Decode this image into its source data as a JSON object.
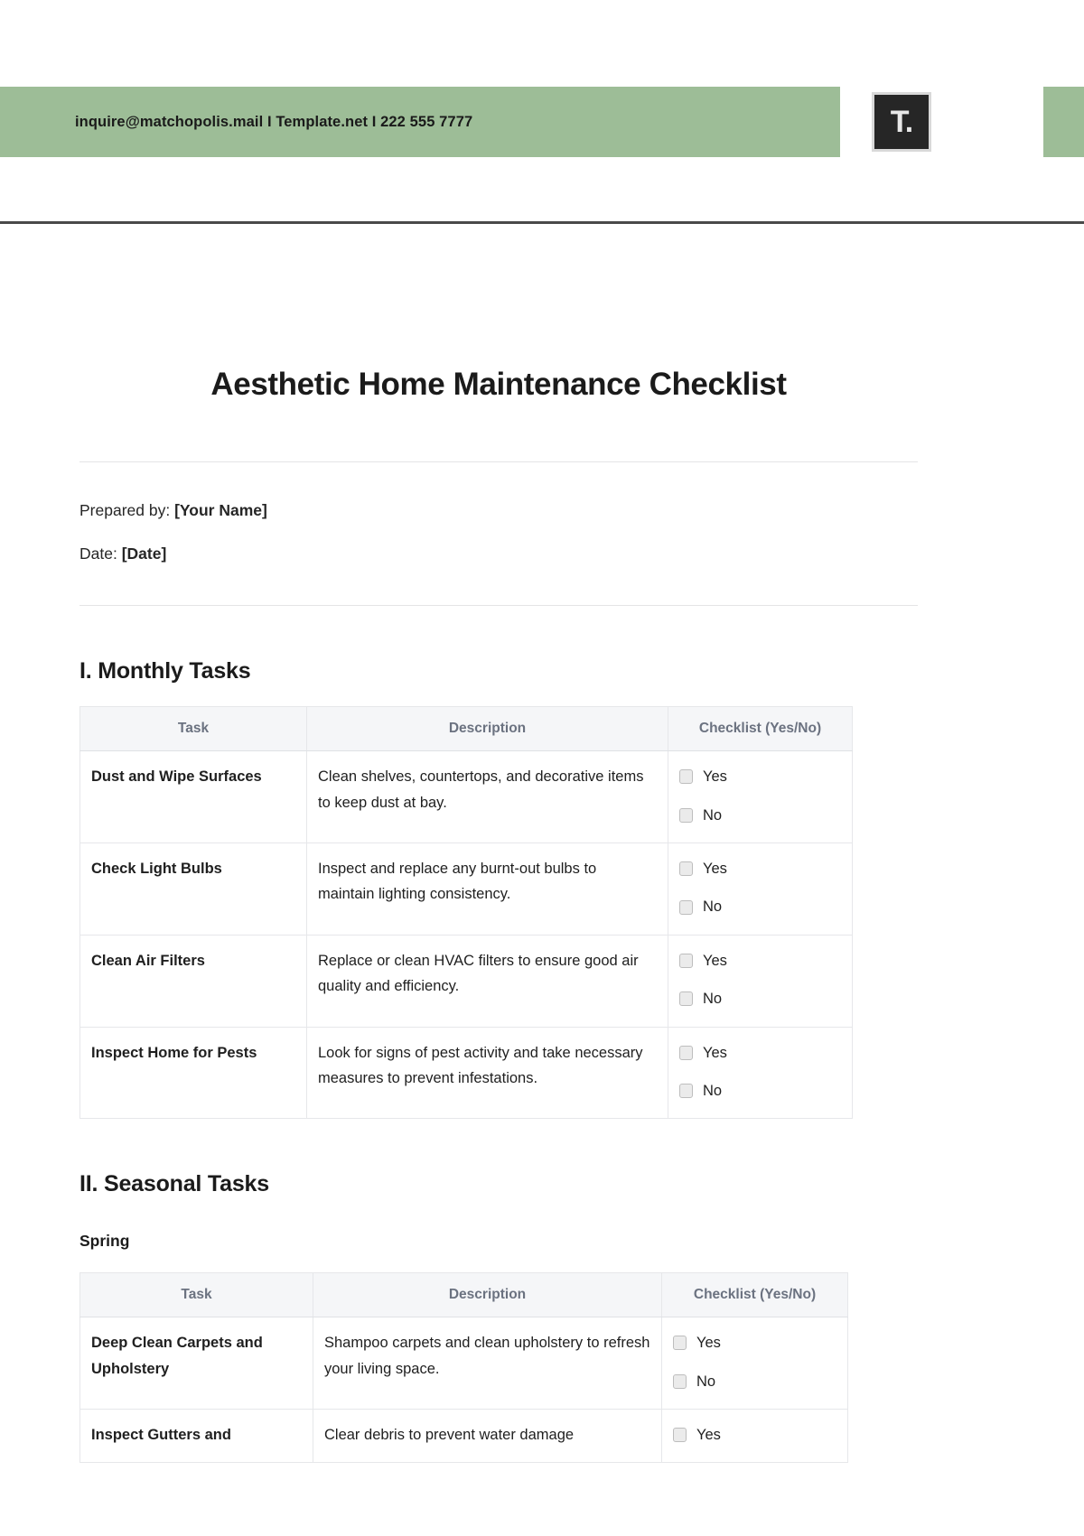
{
  "header": {
    "contact": "inquire@matchopolis.mail  I  Template.net  I 222 555 7777",
    "logo_text": "T.",
    "band_color": "#9dbd97"
  },
  "document": {
    "title": "Aesthetic Home Maintenance Checklist",
    "prepared_by_label": "Prepared by:",
    "prepared_by_value": "[Your Name]",
    "date_label": "Date:",
    "date_value": "[Date]"
  },
  "sections": [
    {
      "heading": "I. Monthly Tasks",
      "columns": [
        "Task",
        "Description",
        "Checklist (Yes/No)"
      ],
      "rows": [
        {
          "task": "Dust and Wipe Surfaces",
          "description": "Clean shelves, countertops, and decorative items to keep dust at bay.",
          "options": [
            "Yes",
            "No"
          ]
        },
        {
          "task": "Check Light Bulbs",
          "description": "Inspect and replace any burnt-out bulbs to maintain lighting consistency.",
          "options": [
            "Yes",
            "No"
          ]
        },
        {
          "task": "Clean Air Filters",
          "description": "Replace or clean HVAC filters to ensure good air quality and efficiency.",
          "options": [
            "Yes",
            "No"
          ]
        },
        {
          "task": "Inspect Home for Pests",
          "description": "Look for signs of pest activity and take necessary measures to prevent infestations.",
          "options": [
            "Yes",
            "No"
          ]
        }
      ]
    },
    {
      "heading": "II. Seasonal Tasks",
      "subheading": "Spring",
      "columns": [
        "Task",
        "Description",
        "Checklist (Yes/No)"
      ],
      "rows": [
        {
          "task": "Deep Clean Carpets and Upholstery",
          "description": "Shampoo carpets and clean upholstery to refresh your living space.",
          "options": [
            "Yes",
            "No"
          ]
        },
        {
          "task": "Inspect Gutters and",
          "description": "Clear debris to prevent water damage",
          "options": [
            "Yes"
          ]
        }
      ]
    }
  ]
}
